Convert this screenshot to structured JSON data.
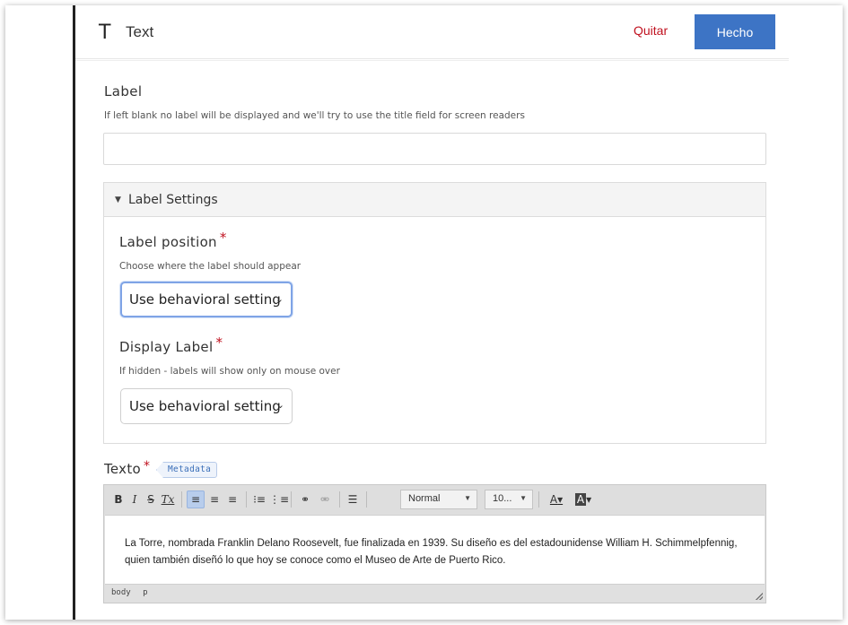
{
  "header": {
    "icon_glyph": "T",
    "title": "Text",
    "remove_label": "Quitar",
    "done_label": "Hecho",
    "done_color": "#3d74c5",
    "remove_color": "#c0111f"
  },
  "label_field": {
    "title": "Label",
    "help": "If left blank no label will be displayed and we'll try to use the title field for screen readers",
    "value": "",
    "placeholder": ""
  },
  "label_settings": {
    "title": "Label Settings",
    "expanded": true,
    "label_position": {
      "title": "Label position",
      "required_mark": "*",
      "help": "Choose where the label should appear",
      "selected": "Use behavioral setting"
    },
    "display_label": {
      "title": "Display Label",
      "required_mark": "*",
      "help": "If hidden - labels will show only on mouse over",
      "selected": "Use behavioral setting"
    }
  },
  "texto": {
    "title": "Texto",
    "required_mark": "*",
    "badge": "Metadata",
    "toolbar": {
      "bold": "B",
      "italic": "I",
      "strike": "S",
      "clear_format": "Tx",
      "format_combo": "Normal",
      "size_combo": "10...",
      "text_color": "A",
      "bg_color": "A"
    },
    "content": "La Torre, nombrada Franklin Delano Roosevelt, fue finalizada en 1939. Su diseño es del estadounidense William H. Schimmelpfennig, quien también diseñó lo que hoy se conoce como el Museo de Arte de Puerto Rico.",
    "path": [
      "body",
      "p"
    ]
  }
}
